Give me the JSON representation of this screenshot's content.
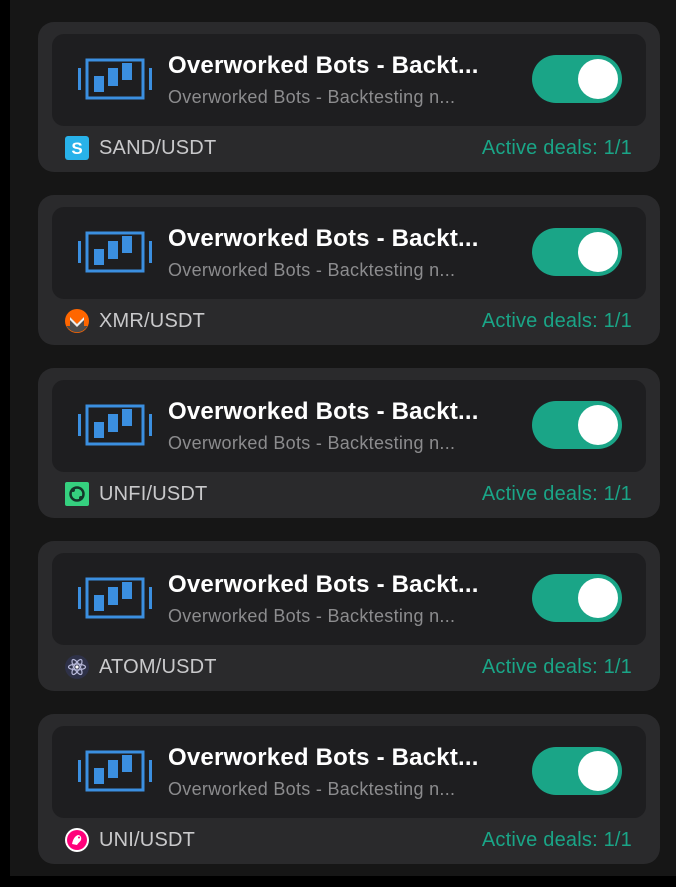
{
  "colors": {
    "accent": "#1aa587",
    "card_bg": "#2a2a2c",
    "inner_bg": "#1e1e20",
    "bot_icon_blue": "#3b8fe0"
  },
  "bots": [
    {
      "title": "Overworked Bots - Backt...",
      "subtitle": "Overworked Bots - Backtesting n...",
      "enabled": true,
      "pair": "SAND/USDT",
      "coin_icon": "sand-icon",
      "deals": "Active deals: 1/1"
    },
    {
      "title": "Overworked Bots - Backt...",
      "subtitle": "Overworked Bots - Backtesting n...",
      "enabled": true,
      "pair": "XMR/USDT",
      "coin_icon": "monero-icon",
      "deals": "Active deals: 1/1"
    },
    {
      "title": "Overworked Bots - Backt...",
      "subtitle": "Overworked Bots - Backtesting n...",
      "enabled": true,
      "pair": "UNFI/USDT",
      "coin_icon": "unfi-icon",
      "deals": "Active deals: 1/1"
    },
    {
      "title": "Overworked Bots - Backt...",
      "subtitle": "Overworked Bots - Backtesting n...",
      "enabled": true,
      "pair": "ATOM/USDT",
      "coin_icon": "cosmos-icon",
      "deals": "Active deals: 1/1"
    },
    {
      "title": "Overworked Bots - Backt...",
      "subtitle": "Overworked Bots - Backtesting n...",
      "enabled": true,
      "pair": "UNI/USDT",
      "coin_icon": "uniswap-icon",
      "deals": "Active deals: 1/1"
    }
  ]
}
